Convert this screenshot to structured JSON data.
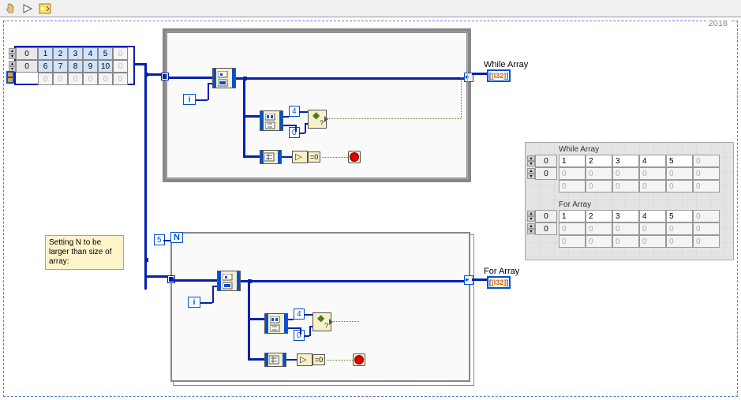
{
  "toolbar": {
    "run_icon": "run-arrow",
    "hand_icon": "hand",
    "highlight_icon": "highlight"
  },
  "year_label": "2018",
  "input_array": {
    "index_values": [
      "0",
      "0"
    ],
    "rows": [
      [
        "1",
        "2",
        "3",
        "4",
        "5",
        "0"
      ],
      [
        "6",
        "7",
        "8",
        "9",
        "10",
        "0"
      ],
      [
        "0",
        "0",
        "0",
        "0",
        "0",
        "0"
      ]
    ],
    "active_rows": 2,
    "active_cols": 5
  },
  "while": {
    "label": "While Array",
    "i_label": "i",
    "const_4": "4",
    "const_0": "0",
    "eq0_label": "=0",
    "indicator_type": "[I32]"
  },
  "for": {
    "label": "For Array",
    "i_label": "i",
    "n_label": "N",
    "n_value": "5",
    "const_4": "4",
    "const_0": "0",
    "eq0_label": "=0",
    "indicator_type": "[I32]"
  },
  "comment_text": "Setting N to be larger than size of array:",
  "panel": {
    "while_label": "While Array",
    "for_label": "For Array",
    "idx": [
      "0",
      "0"
    ],
    "while_rows": [
      [
        "1",
        "2",
        "3",
        "4",
        "5",
        "0"
      ],
      [
        "0",
        "0",
        "0",
        "0",
        "0",
        "0"
      ],
      [
        "0",
        "0",
        "0",
        "0",
        "0",
        "0"
      ]
    ],
    "for_rows": [
      [
        "1",
        "2",
        "3",
        "4",
        "5",
        "0"
      ],
      [
        "0",
        "0",
        "0",
        "0",
        "0",
        "0"
      ],
      [
        "0",
        "0",
        "0",
        "0",
        "0",
        "0"
      ]
    ],
    "active_cols": 5
  },
  "chart_data": {
    "type": "table",
    "title": "Indexing Tunnel Output Comparison (Block Diagram)",
    "input_2d_array": [
      [
        1,
        2,
        3,
        4,
        5
      ],
      [
        6,
        7,
        8,
        9,
        10
      ]
    ],
    "while_loop_output": [
      [
        1,
        2,
        3,
        4,
        5
      ]
    ],
    "for_loop_output": [
      [
        1,
        2,
        3,
        4,
        5
      ]
    ],
    "for_loop_N": 5
  }
}
